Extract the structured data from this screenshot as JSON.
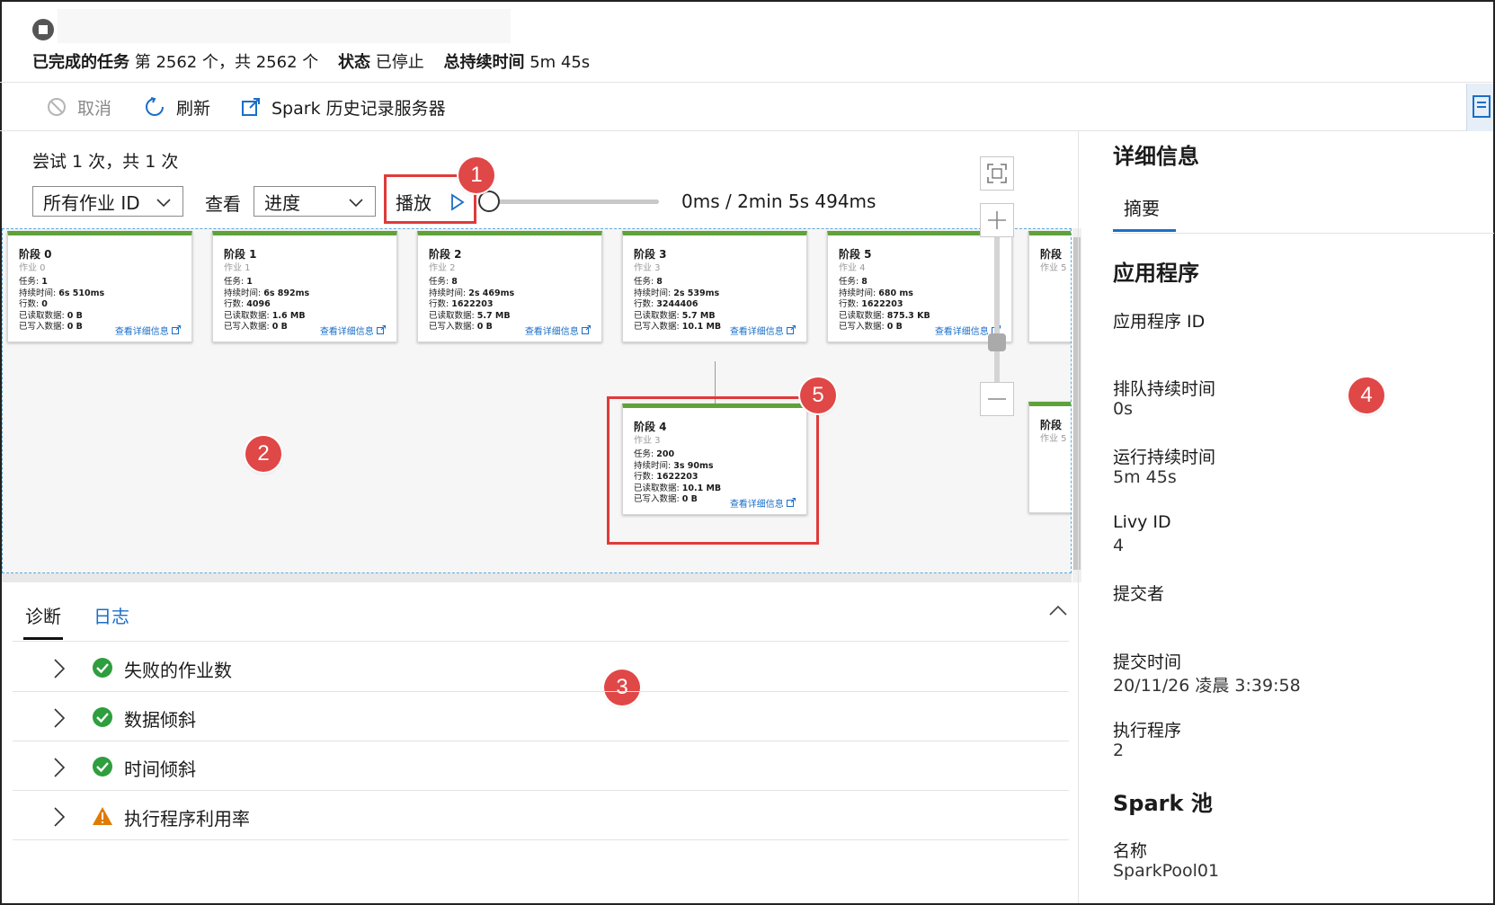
{
  "header": {
    "completed_label": "已完成的任务",
    "completed_value": "第 2562 个，共 2562 个",
    "status_label": "状态",
    "status_value": "已停止",
    "duration_label": "总持续时间",
    "duration_value": "5m 45s"
  },
  "toolbar": {
    "cancel": "取消",
    "refresh": "刷新",
    "spark_history": "Spark 历史记录服务器"
  },
  "graph": {
    "attempt": "尝试 1 次，共 1 次",
    "job_filter": "所有作业 ID",
    "view_label": "查看",
    "view_value": "进度",
    "play": "播放",
    "playback_time": "0ms / 2min 5s 494ms",
    "stages": [
      {
        "title": "阶段 0",
        "job": "作业 0",
        "tasks": "1",
        "duration": "6s 510ms",
        "rows": "0",
        "read": "0 B",
        "written": "0 B"
      },
      {
        "title": "阶段 1",
        "job": "作业 1",
        "tasks": "1",
        "duration": "6s 892ms",
        "rows": "4096",
        "read": "1.6 MB",
        "written": "0 B"
      },
      {
        "title": "阶段 2",
        "job": "作业 2",
        "tasks": "8",
        "duration": "2s 469ms",
        "rows": "1622203",
        "read": "5.7 MB",
        "written": "0 B"
      },
      {
        "title": "阶段 3",
        "job": "作业 3",
        "tasks": "8",
        "duration": "2s 539ms",
        "rows": "3244406",
        "read": "5.7 MB",
        "written": "10.1 MB"
      },
      {
        "title": "阶段 5",
        "job": "作业 4",
        "tasks": "8",
        "duration": "680 ms",
        "rows": "1622203",
        "read": "875.3 KB",
        "written": "0 B"
      },
      {
        "title": "阶段 4",
        "job": "作业 3",
        "tasks": "200",
        "duration": "3s 90ms",
        "rows": "1622203",
        "read": "10.1 MB",
        "written": "0 B"
      }
    ],
    "partial_stage_title": "阶段",
    "partial_stage_job": "作业 5",
    "labels": {
      "tasks": "任务:",
      "duration": "持续时间:",
      "rows": "行数:",
      "read": "已读取数据:",
      "written": "已写入数据:",
      "details_link": "查看详细信息"
    }
  },
  "diagnostics": {
    "tabs": [
      "诊断",
      "日志"
    ],
    "rows": [
      {
        "label": "失败的作业数",
        "status": "success"
      },
      {
        "label": "数据倾斜",
        "status": "success"
      },
      {
        "label": "时间倾斜",
        "status": "success"
      },
      {
        "label": "执行程序利用率",
        "status": "warning"
      }
    ]
  },
  "details": {
    "title": "详细信息",
    "tab": "摘要",
    "app_section": "应用程序",
    "app_id_label": "应用程序 ID",
    "queue_label": "排队持续时间",
    "queue_value": "0s",
    "run_label": "运行持续时间",
    "run_value": "5m 45s",
    "livy_label": "Livy ID",
    "livy_value": "4",
    "submitter_label": "提交者",
    "submit_time_label": "提交时间",
    "submit_time_value": "20/11/26 凌晨 3:39:58",
    "executors_label": "执行程序",
    "executors_value": "2",
    "pool_section": "Spark 池",
    "name_label": "名称",
    "name_value": "SparkPool01"
  },
  "callouts": [
    "1",
    "2",
    "3",
    "4",
    "5"
  ],
  "colors": {
    "accent": "#1a6ec8",
    "stage_bar": "#5fa23a",
    "callout": "#e04747",
    "success": "#2e9e3e",
    "warning": "#e07b00"
  }
}
